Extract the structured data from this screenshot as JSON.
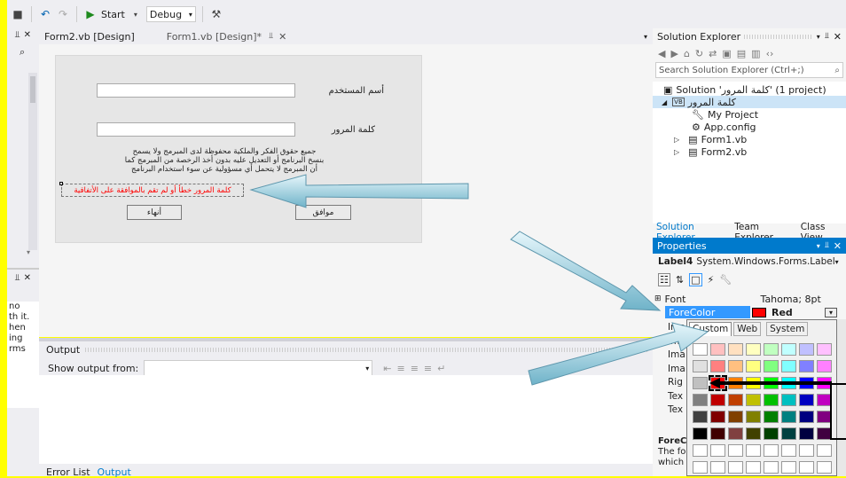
{
  "toolbar": {
    "start_label": "Start",
    "config_value": "Debug"
  },
  "tabs": [
    {
      "label": "Form2.vb [Design]"
    },
    {
      "label": "Form1.vb [Design]*"
    }
  ],
  "form": {
    "username_label": "أسم المستخدم",
    "password_label": "كلمة المرور",
    "copyright_line1": "جميع حقوق الفكر والملكية محفوظة لدى المبرمج ولا يسمح",
    "copyright_line2": "بنسخ البرنامج أو التعديل عليه بدون أخذ الرخصة من المبرمج كما",
    "copyright_line3": "أن المبرمج لا يتحمل أي مسؤولية عن سوء استخدام البرنامج",
    "error_label": "كلمة المرور خطأ أو لم تقم بالموافقة على الأتفاقية",
    "ok_button": "موافق",
    "exit_button": "أنهاء"
  },
  "output": {
    "title": "Output",
    "show_from": "Show output from:",
    "tabs": [
      "Error List",
      "Output"
    ]
  },
  "left_fragments": [
    "no",
    "th it.",
    "hen",
    "ing",
    "rms"
  ],
  "solution_explorer": {
    "title": "Solution Explorer",
    "search_placeholder": "Search Solution Explorer (Ctrl+;)",
    "items": [
      {
        "label": "Solution 'كلمة المرور' (1 project)"
      },
      {
        "label": "كلمة المرور"
      },
      {
        "label": "My Project"
      },
      {
        "label": "App.config"
      },
      {
        "label": "Form1.vb"
      },
      {
        "label": "Form2.vb"
      }
    ],
    "bottom_tabs": [
      "Solution Explorer",
      "Team Explorer",
      "Class View"
    ]
  },
  "properties": {
    "title": "Properties",
    "object": "Label4",
    "object_type": "System.Windows.Forms.Label",
    "rows": [
      {
        "name": "Font",
        "value": "Tahoma; 8pt"
      },
      {
        "name": "ForeColor",
        "value": "Red"
      }
    ],
    "partial_names": [
      "Ima",
      "Ima",
      "Ima",
      "Ima",
      "Rig",
      "Tex",
      "Tex"
    ],
    "description_title": "ForeC",
    "description_line1": "The fo",
    "description_line2": "which"
  },
  "color_picker": {
    "tabs": [
      "Custom",
      "Web",
      "System"
    ],
    "colors": [
      [
        "#ffffff",
        "#ffc0c0",
        "#ffe0c0",
        "#ffffc0",
        "#c0ffc0",
        "#c0ffff",
        "#c0c0ff",
        "#ffc0ff"
      ],
      [
        "#e0e0e0",
        "#ff8080",
        "#ffc080",
        "#ffff80",
        "#80ff80",
        "#80ffff",
        "#8080ff",
        "#ff80ff"
      ],
      [
        "#c0c0c0",
        "#ff0000",
        "#ff8000",
        "#ffff00",
        "#00ff00",
        "#00ffff",
        "#0000ff",
        "#ff00ff"
      ],
      [
        "#808080",
        "#c00000",
        "#c04000",
        "#c0c000",
        "#00c000",
        "#00c0c0",
        "#0000c0",
        "#c000c0"
      ],
      [
        "#404040",
        "#800000",
        "#804000",
        "#808000",
        "#008000",
        "#008080",
        "#000080",
        "#800080"
      ],
      [
        "#000000",
        "#400000",
        "#804040",
        "#404000",
        "#004000",
        "#004040",
        "#000040",
        "#400040"
      ],
      [
        "#ffffff",
        "#ffffff",
        "#ffffff",
        "#ffffff",
        "#ffffff",
        "#ffffff",
        "#ffffff",
        "#ffffff"
      ],
      [
        "#ffffff",
        "#ffffff",
        "#ffffff",
        "#ffffff",
        "#ffffff",
        "#ffffff",
        "#ffffff",
        "#ffffff"
      ]
    ],
    "selected_color": "#ff0000"
  },
  "colors": {
    "accent": "#007acc",
    "highlight": "#3399ff",
    "red": "#ff0000"
  }
}
